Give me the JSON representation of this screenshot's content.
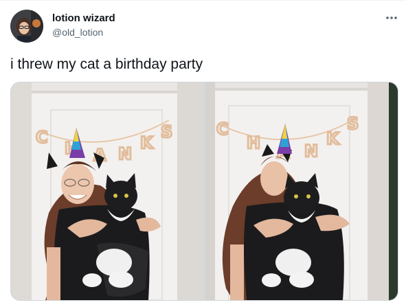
{
  "tweet": {
    "display_name": "lotion wizard",
    "handle": "@old_lotion",
    "text": "i threw my cat a birthday party",
    "more_icon": "more-horizontal-icon",
    "photos": [
      {
        "alt": "photo 1"
      },
      {
        "alt": "photo 2"
      }
    ]
  },
  "banner_letters": [
    "C",
    "H",
    "A",
    "N",
    "K",
    "S"
  ],
  "colors": {
    "text_primary": "#0f1419",
    "text_secondary": "#536471",
    "border": "#cfd9de",
    "wall": "#ece9e6",
    "door": "#f2f0ee",
    "banner": "#e7c6a8"
  }
}
